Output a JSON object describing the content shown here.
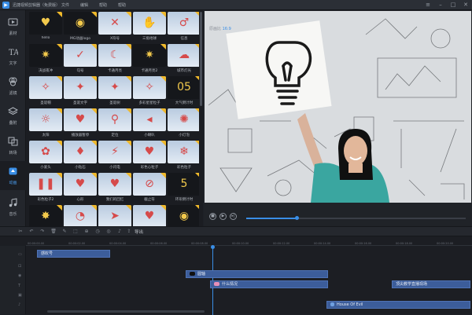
{
  "app": {
    "title": "迅捷视频剪辑器（免费版）"
  },
  "menu": {
    "items": [
      "文件",
      "编辑",
      "帮助",
      "帮助"
    ]
  },
  "sidebar": {
    "items": [
      {
        "label": "素材",
        "icon": "media-icon"
      },
      {
        "label": "文字",
        "icon": "text-icon"
      },
      {
        "label": "滤镜",
        "icon": "filter-icon"
      },
      {
        "label": "叠附",
        "icon": "overlay-icon"
      },
      {
        "label": "转场",
        "icon": "transition-icon"
      },
      {
        "label": "动画",
        "icon": "animation-icon"
      },
      {
        "label": "音乐",
        "icon": "music-icon"
      }
    ],
    "active": "动画"
  },
  "library": {
    "tiles": [
      {
        "caption": "hello",
        "icon": "shield-icon",
        "sym": "♥",
        "dark": true
      },
      {
        "caption": "MG动画logo",
        "icon": "bulb-icon",
        "sym": "◉",
        "dark": true
      },
      {
        "caption": "X符号",
        "icon": "cross-icon",
        "sym": "✕"
      },
      {
        "caption": "三角地球",
        "icon": "globe-icon",
        "sym": "✋"
      },
      {
        "caption": "信息",
        "icon": "speech-icon",
        "sym": "♂"
      },
      {
        "caption": "决战夜冲",
        "icon": "fire-icon",
        "sym": "✷",
        "dark": true
      },
      {
        "caption": "勾号",
        "icon": "check-icon",
        "sym": "✓"
      },
      {
        "caption": "卡通月亮",
        "icon": "moon-icon",
        "sym": "☾"
      },
      {
        "caption": "卡通月亮2",
        "icon": "fire-icon",
        "sym": "✷",
        "dark": true
      },
      {
        "caption": "城市灯光",
        "icon": "city-icon",
        "sym": "☁"
      },
      {
        "caption": "圣诞帽",
        "icon": "hat-icon",
        "sym": "✧"
      },
      {
        "caption": "圣诞文字",
        "icon": "text-icon",
        "sym": "✦"
      },
      {
        "caption": "圣诞树",
        "icon": "tree-icon",
        "sym": "✦"
      },
      {
        "caption": "多彩星星粒子",
        "icon": "star-icon",
        "sym": "✧"
      },
      {
        "caption": "大气倒计时",
        "icon": "countdown-icon",
        "sym": "05",
        "dark": true
      },
      {
        "caption": "太阳",
        "icon": "sun-icon",
        "sym": "☼"
      },
      {
        "caption": "播放器暂停",
        "icon": "heart-icon",
        "sym": "♥"
      },
      {
        "caption": "定位",
        "icon": "pin-icon",
        "sym": "⚲"
      },
      {
        "caption": "小喇叭",
        "icon": "megaphone-icon",
        "sym": "◂"
      },
      {
        "caption": "小灯泡",
        "icon": "bulb-icon",
        "sym": "✺"
      },
      {
        "caption": "小爱头",
        "icon": "bunny-icon",
        "sym": "✿"
      },
      {
        "caption": "小钻石",
        "icon": "diamond-icon",
        "sym": "♦"
      },
      {
        "caption": "小闪电",
        "icon": "lightning-icon",
        "sym": "⚡"
      },
      {
        "caption": "彩色心粒子",
        "icon": "hearts-icon",
        "sym": "♥"
      },
      {
        "caption": "彩色粒子",
        "icon": "particles-icon",
        "sym": "❄"
      },
      {
        "caption": "彩色粒子2",
        "icon": "sparks-icon",
        "sym": "❚❚"
      },
      {
        "caption": "心形",
        "icon": "heart-icon",
        "sym": "♥"
      },
      {
        "caption": "我们的回忆",
        "icon": "heart-frame-icon",
        "sym": "♥"
      },
      {
        "caption": "截止符",
        "icon": "forbidden-icon",
        "sym": "⊘"
      },
      {
        "caption": "环形倒计时",
        "icon": "countdown-icon",
        "sym": "5",
        "dark": true
      },
      {
        "caption": "",
        "icon": "",
        "sym": "✸",
        "dark": true
      },
      {
        "caption": "",
        "icon": "",
        "sym": "◔"
      },
      {
        "caption": "",
        "icon": "",
        "sym": "➤"
      },
      {
        "caption": "",
        "icon": "",
        "sym": "♥"
      },
      {
        "caption": "",
        "icon": "",
        "sym": "◉",
        "dark": true
      }
    ]
  },
  "player": {
    "current_time": "00:00:10.06",
    "label": "原画比",
    "ratio": "16:9"
  },
  "toolbar": {
    "export_label": "导出"
  },
  "ruler": {
    "ticks": [
      "00:00:00.00",
      "00:00:02.00",
      "00:00:04.00",
      "00:00:06.00",
      "00:00:08.00",
      "00:00:10.00",
      "00:00:12.00",
      "00:00:14.00",
      "00:00:16.00",
      "00:00:18.00",
      "00:00:20.00"
    ]
  },
  "timeline": {
    "clips": [
      {
        "label": "感叹号",
        "icon": ""
      },
      {
        "label": "圆轴",
        "icon": "dark"
      },
      {
        "label": "什么情况",
        "icon": "pink"
      },
      {
        "label": "顶尖教学直播现场",
        "icon": ""
      },
      {
        "label": "House Of Evil",
        "icon": "blue"
      }
    ]
  },
  "colors": {
    "accent": "#3a8ee6",
    "clip": "#3c5d9a",
    "star_badge": "#f0b92b"
  }
}
